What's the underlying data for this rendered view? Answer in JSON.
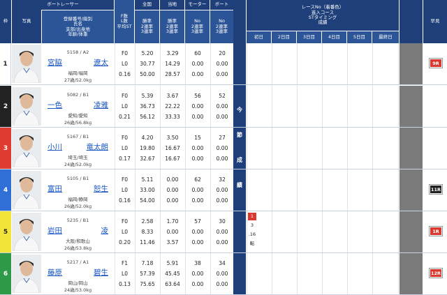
{
  "header": {
    "waku": "枠",
    "photo": "写真",
    "boat_racer": "ボートレーサー",
    "racer_info": [
      "登録番号/級別",
      "氏名",
      "支部/出身地",
      "年齢/体重"
    ],
    "zenkoku": "全国",
    "touchi": "当地",
    "motor": "モーター",
    "boat": "ボート",
    "fls": [
      "F数",
      "L数",
      "平均ST"
    ],
    "win_rate": [
      "勝率",
      "2連率",
      "3連率"
    ],
    "no_rate": [
      "No",
      "2連率",
      "3連率"
    ],
    "race_info": [
      "レースNo（着番色）",
      "進入コース",
      "STタイミング",
      "成績"
    ],
    "days": [
      "初日",
      "2日目",
      "3日目",
      "4日目",
      "5日目",
      "最終日"
    ],
    "sokuhou": "早見",
    "konsetsu": [
      "今",
      "節",
      "成",
      "績"
    ]
  },
  "racers": [
    {
      "waku": "1",
      "waku_bg": "#ffffff",
      "waku_fg": "#222222",
      "regno": "5158 / A2",
      "name_last": "宮脇",
      "name_first": "遼太",
      "branch": "福岡/福岡",
      "age": "27歳/52.0kg",
      "f": "F0",
      "l": "L0",
      "st": "0.16",
      "z1": "5.20",
      "z2": "30.77",
      "z3": "50.00",
      "t1": "3.29",
      "t2": "14.29",
      "t3": "28.57",
      "m1": "60",
      "m2": "0.00",
      "m3": "0.00",
      "b1": "20",
      "b2": "0.00",
      "b3": "0.00",
      "badge": "9R",
      "badge_color": "red",
      "results": []
    },
    {
      "waku": "2",
      "waku_bg": "#222222",
      "waku_fg": "#ffffff",
      "regno": "5082 / B1",
      "name_last": "一色",
      "name_first": "凌雅",
      "branch": "愛知/愛知",
      "age": "26歳/56.8kg",
      "f": "F0",
      "l": "L0",
      "st": "0.21",
      "z1": "5.39",
      "z2": "36.73",
      "z3": "56.12",
      "t1": "3.67",
      "t2": "22.22",
      "t3": "33.33",
      "m1": "56",
      "m2": "0.00",
      "m3": "0.00",
      "b1": "52",
      "b2": "0.00",
      "b3": "0.00",
      "badge": "",
      "badge_color": "",
      "results": []
    },
    {
      "waku": "3",
      "waku_bg": "#e03c31",
      "waku_fg": "#ffffff",
      "regno": "5167 / B1",
      "name_last": "小川",
      "name_first": "竜太朗",
      "branch": "埼玉/埼玉",
      "age": "24歳/52.0kg",
      "f": "F0",
      "l": "L0",
      "st": "0.17",
      "z1": "4.20",
      "z2": "19.80",
      "z3": "32.67",
      "t1": "3.50",
      "t2": "16.67",
      "t3": "16.67",
      "m1": "15",
      "m2": "0.00",
      "m3": "0.00",
      "b1": "27",
      "b2": "0.00",
      "b3": "0.00",
      "badge": "",
      "badge_color": "",
      "results": []
    },
    {
      "waku": "4",
      "waku_bg": "#2f6fd6",
      "waku_fg": "#ffffff",
      "regno": "5105 / B1",
      "name_last": "富田",
      "name_first": "恕生",
      "branch": "福岡/静岡",
      "age": "26歳/52.0kg",
      "f": "F0",
      "l": "L0",
      "st": "0.16",
      "z1": "5.11",
      "z2": "33.00",
      "z3": "54.00",
      "t1": "0.00",
      "t2": "0.00",
      "t3": "0.00",
      "m1": "62",
      "m2": "0.00",
      "m3": "0.00",
      "b1": "32",
      "b2": "0.00",
      "b3": "0.00",
      "badge": "11R",
      "badge_color": "black",
      "results": []
    },
    {
      "waku": "5",
      "waku_bg": "#f3e43a",
      "waku_fg": "#222222",
      "regno": "5235 / B1",
      "name_last": "岩田",
      "name_first": "凌",
      "branch": "大阪/和歌山",
      "age": "26歳/53.8kg",
      "f": "F0",
      "l": "L0",
      "st": "0.20",
      "z1": "2.58",
      "z2": "8.33",
      "z3": "11.46",
      "t1": "1.70",
      "t2": "0.00",
      "t3": "3.57",
      "m1": "57",
      "m2": "0.00",
      "m3": "0.00",
      "b1": "30",
      "b2": "0.00",
      "b3": "0.00",
      "badge": "1R",
      "badge_color": "red",
      "results": [
        "1",
        "3",
        ".16",
        "転"
      ]
    },
    {
      "waku": "6",
      "waku_bg": "#2e9a48",
      "waku_fg": "#ffffff",
      "regno": "5217 / A1",
      "name_last": "藤原",
      "name_first": "碧生",
      "branch": "岡山/岡山",
      "age": "24歳/53.0kg",
      "f": "F1",
      "l": "L0",
      "st": "0.13",
      "z1": "7.18",
      "z2": "57.39",
      "z3": "75.65",
      "t1": "5.91",
      "t2": "45.45",
      "t3": "63.64",
      "m1": "38",
      "m2": "0.00",
      "m3": "0.00",
      "b1": "34",
      "b2": "0.00",
      "b3": "0.00",
      "badge": "12R",
      "badge_color": "red",
      "results": []
    }
  ],
  "colors": {
    "header": "#1e3f7a",
    "subheader": "#2c5597",
    "link": "#1a56c4",
    "gray_col": "#7a7a7a"
  }
}
